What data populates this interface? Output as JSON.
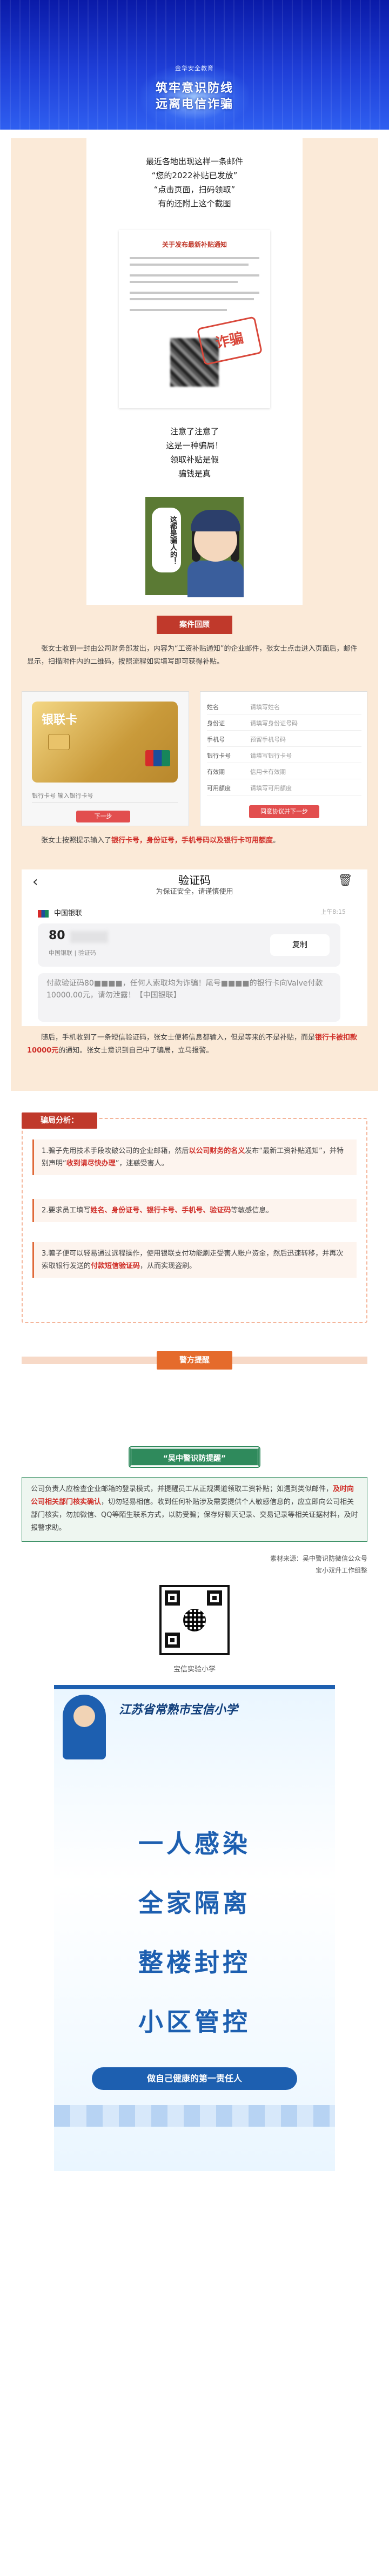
{
  "banner": {
    "brand": "金华安全教育",
    "title_line1": "筑牢意识防线",
    "title_line2": "远离电信诈骗"
  },
  "intro": {
    "lines": [
      "最近各地出现这样一条邮件",
      "“您的2022补贴已发放”",
      "“点击页面，扫码领取”",
      "有的还附上这个截图"
    ]
  },
  "notice": {
    "title": "关于发布最新补贴通知",
    "stamp": "诈骗"
  },
  "outro": {
    "lines": [
      "注意了注意了",
      "这是一种骗局！",
      "领取补贴是假",
      "骗钱是真"
    ]
  },
  "police": {
    "bubble": "这都是骗人的！"
  },
  "case": {
    "tag": "案件回顾",
    "paragraph": "张女士收到一封由公司财务部发出，内容为“工资补贴通知”的企业邮件，张女士点击进入页面后，邮件显示，扫描附件内的二维码，按照流程如实填写即可获得补贴。",
    "after_part1": "张女士按照提示输入了",
    "after_red": "银行卡号，身份证号，手机号码以及银行卡可用额度",
    "after_part2": "。"
  },
  "bankcard": {
    "label": "银联卡",
    "field1": "银行卡号  输入银行卡号",
    "btn": "下一步"
  },
  "form": {
    "rows": [
      {
        "k": "姓名",
        "v": "请填写姓名"
      },
      {
        "k": "身份证",
        "v": "请填写身份证号码"
      },
      {
        "k": "手机号",
        "v": "预留手机号码"
      },
      {
        "k": "银行卡号",
        "v": "请填写银行卡号"
      },
      {
        "k": "有效期",
        "v": "信用卡有效期"
      },
      {
        "k": "可用额度",
        "v": "请填写可用额度"
      }
    ],
    "btn": "同意协议并下一步"
  },
  "sms": {
    "back": "‹",
    "title": "验证码",
    "subtitle": "为保证安全，请谨慎使用",
    "trash": "🗑",
    "bank": "中国银联",
    "time": "上午8:15",
    "code_prefix": "80",
    "code_source": "中国银联 | 验证码",
    "copy": "复制",
    "message": "付款验证码80■■■■，任何人索取均为诈骗！尾号■■■■的银行卡向Valve付款10000.00元，请勿泄露！【中国银联】"
  },
  "follow": {
    "part1": "随后，手机收到了一条短信验证码，张女士便将信息都输入，但是等来的不是补贴，而是",
    "red": "银行卡被扣款10000元",
    "part2": "的通知。张女士意识到自己中了骗局，立马报警。"
  },
  "analysis": {
    "tag": "骗局分析：",
    "items": [
      {
        "p1": "1.骗子先用技术手段攻破公司的企业邮箱，然后",
        "red": "以公司财务的名义",
        "p2": "发布“最新工资补贴通知”，并特别声明“",
        "red2": "收到请尽快办理",
        "p3": "”，迷惑受害人。"
      },
      {
        "p1": "2.要求员工填写",
        "red": "姓名、身份证号、银行卡号、手机号、验证码",
        "p2": "等敏感信息。",
        "red2": "",
        "p3": ""
      },
      {
        "p1": "3.骗子便可以轻易通过远程操作，使用银联支付功能刷走受害人账户资金，然后迅速转移，并再次索取银行发送的",
        "red": "付款短信验证码",
        "p2": "，从而实现盗刷。",
        "red2": "",
        "p3": ""
      }
    ]
  },
  "prevention": {
    "tag": "警方提醒"
  },
  "tip": {
    "head": "“吴中警识防提醒”",
    "text_p1": "公司负责人应检查企业邮箱的登录模式，并提醒员工从正规渠道领取工资补贴；如遇到类似邮件，",
    "text_red": "及时向公司相关部门核实确认",
    "text_p2": "，切勿轻易相信。收到任何补贴涉及需要提供个人敏感信息的，应立即向公司相关部门核实，勿加微信、QQ等陌生联系方式，以防受骗；保存好聊天记录、交易记录等相关证据材料，及时报警求助。"
  },
  "source": {
    "line1": "素材来源：吴中警识防微信公众号",
    "line2": "宝小双升工作组整"
  },
  "school": "宝信实验小学",
  "poster": {
    "head": "江苏省常熟市宝信小学",
    "lines": [
      "一人感染",
      "全家隔离",
      "整楼封控",
      "小区管控"
    ],
    "foot": "做自己健康的第一责任人"
  }
}
